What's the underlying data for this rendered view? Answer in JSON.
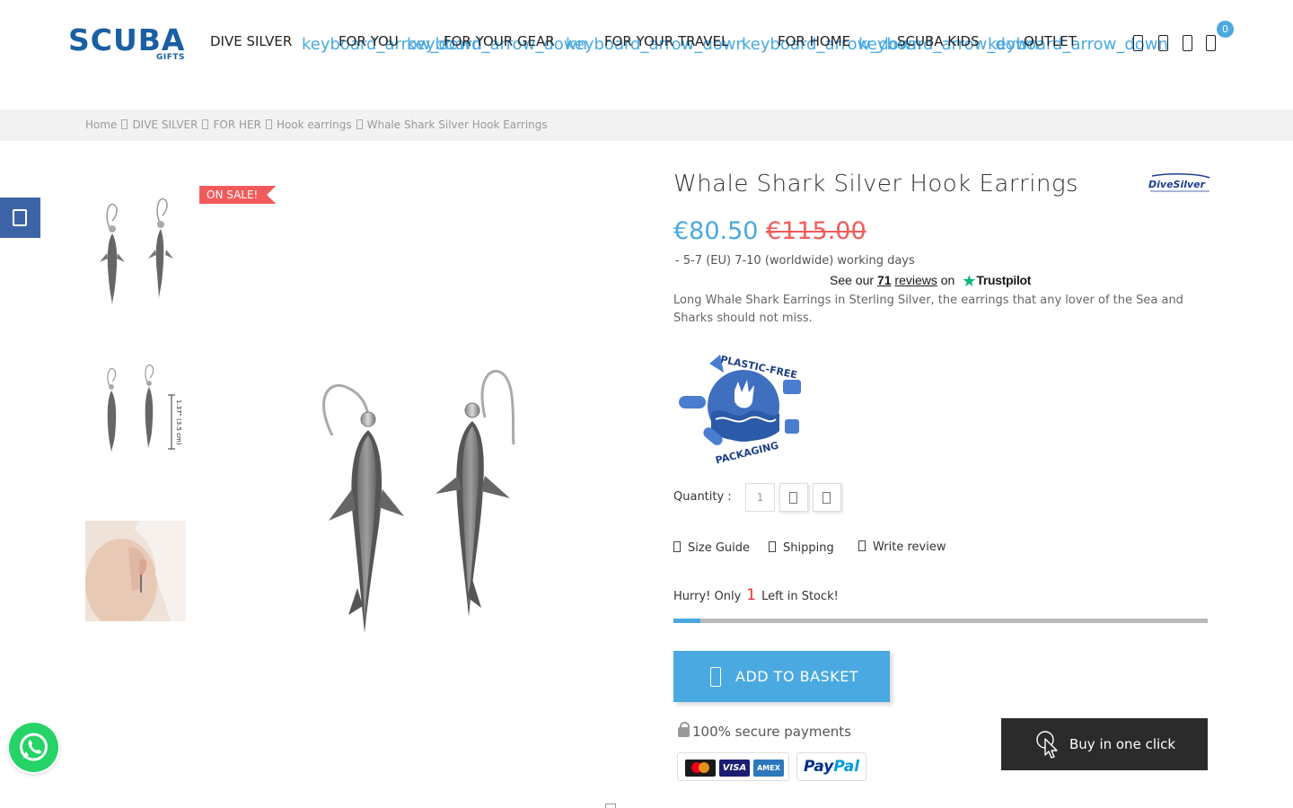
{
  "header": {
    "logo_text": "SCUBA",
    "logo_sub": "GIFTS",
    "nav": [
      {
        "label": "DIVE SILVER"
      },
      {
        "label": "FOR YOU"
      },
      {
        "label": "FOR YOUR GEAR"
      },
      {
        "label": "FOR YOUR TRAVEL"
      },
      {
        "label": "FOR HOME"
      },
      {
        "label": "SCUBA KIDS"
      },
      {
        "label": "OUTLET"
      }
    ],
    "nav_icon_text": "keyboard_arrow_down",
    "cart_count": "0"
  },
  "breadcrumb": [
    "Home",
    "DIVE SILVER",
    "FOR HER",
    "Hook earrings",
    "Whale Shark Silver Hook Earrings"
  ],
  "product": {
    "sale_badge": "ON SALE!",
    "title": "Whale Shark Silver Hook Earrings",
    "brand_logo_text": "DiveSilver",
    "price_new": "€80.50",
    "price_old": "€115.00",
    "delivery": "- 5-7 (EU) 7-10 (worldwide) working days",
    "trustpilot": {
      "prefix": "See our",
      "count": "71",
      "reviews": "reviews",
      "on": "on",
      "brand": "Trustpilot"
    },
    "description": "Long Whale Shark Earrings in Sterling Silver, the earrings that any lover of the Sea and Sharks should not miss.",
    "badge_text_top": "PLASTIC-FREE",
    "badge_text_bottom": "PACKAGING",
    "quantity_label": "Quantity :",
    "quantity_value": "1",
    "links": {
      "size_guide": "Size Guide",
      "shipping": "Shipping",
      "write_review": "Write review"
    },
    "stock": {
      "prefix": "Hurry! Only",
      "count": "1",
      "suffix": "Left in Stock!",
      "level": 0.05
    },
    "add_to_basket": "ADD TO BASKET",
    "secure_payments": "100% secure payments",
    "buy_one_click": "Buy in one click",
    "thumb_measure": "1.37\" (3.5 cm)"
  },
  "payment": {
    "visa": "VISA",
    "amex": "AMEX",
    "paypal_1": "Pay",
    "paypal_2": "Pal"
  },
  "colors": {
    "accent": "#4aa9e0",
    "sale": "#f25b5b",
    "side_tab": "#3e64a8",
    "whatsapp": "#25d366",
    "dark_button": "#2b2b2b"
  },
  "icons": [
    "search-icon",
    "user-icon",
    "heart-icon",
    "cart-icon",
    "whatsapp-icon",
    "facebook-icon",
    "basket-icon",
    "pointer-icon",
    "lock-icon"
  ]
}
